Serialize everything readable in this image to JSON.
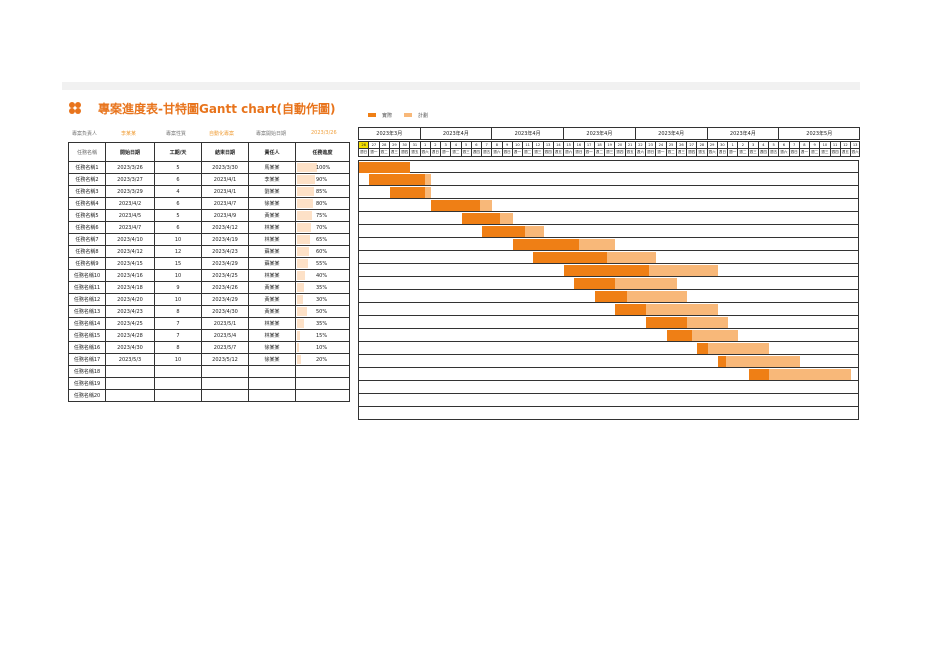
{
  "title": "專案進度表-甘特圖Gantt chart(自動作圖)",
  "info": {
    "owner_label": "專案負責人",
    "owner_value": "李某某",
    "category_label": "專案性質",
    "category_value": "自動化專案",
    "start_label": "專案開始日期",
    "start_value": "2023/3/26"
  },
  "legend": {
    "actual": "實際",
    "plan": "計劃"
  },
  "colors": {
    "actual": "#ef7f15",
    "plan": "#f8b879",
    "accent": "#e8741c",
    "today": "#f4de00",
    "progress": "#fde1c7"
  },
  "table": {
    "headers": [
      "任務名稱",
      "開始日期",
      "工期/天",
      "結束日期",
      "責任人",
      "任務進度"
    ],
    "rows": [
      [
        "任務名稱1",
        "2023/3/26",
        "5",
        "2023/3/30",
        "馬某某",
        "100%"
      ],
      [
        "任務名稱2",
        "2023/3/27",
        "6",
        "2023/4/1",
        "李某某",
        "90%"
      ],
      [
        "任務名稱3",
        "2023/3/29",
        "4",
        "2023/4/1",
        "劉某某",
        "85%"
      ],
      [
        "任務名稱4",
        "2023/4/2",
        "6",
        "2023/4/7",
        "徐某某",
        "80%"
      ],
      [
        "任務名稱5",
        "2023/4/5",
        "5",
        "2023/4/9",
        "黃某某",
        "75%"
      ],
      [
        "任務名稱6",
        "2023/4/7",
        "6",
        "2023/4/12",
        "林某某",
        "70%"
      ],
      [
        "任務名稱7",
        "2023/4/10",
        "10",
        "2023/4/19",
        "林某某",
        "65%"
      ],
      [
        "任務名稱8",
        "2023/4/12",
        "12",
        "2023/4/23",
        "蘇某某",
        "60%"
      ],
      [
        "任務名稱9",
        "2023/4/15",
        "15",
        "2023/4/29",
        "蘇某某",
        "55%"
      ],
      [
        "任務名稱10",
        "2023/4/16",
        "10",
        "2023/4/25",
        "林某某",
        "40%"
      ],
      [
        "任務名稱11",
        "2023/4/18",
        "9",
        "2023/4/26",
        "黃某某",
        "35%"
      ],
      [
        "任務名稱12",
        "2023/4/20",
        "10",
        "2023/4/29",
        "黃某某",
        "30%"
      ],
      [
        "任務名稱13",
        "2023/4/23",
        "8",
        "2023/4/30",
        "黃某某",
        "50%"
      ],
      [
        "任務名稱14",
        "2023/4/25",
        "7",
        "2023/5/1",
        "林某某",
        "35%"
      ],
      [
        "任務名稱15",
        "2023/4/28",
        "7",
        "2023/5/4",
        "林某某",
        "15%"
      ],
      [
        "任務名稱16",
        "2023/4/30",
        "8",
        "2023/5/7",
        "徐某某",
        "10%"
      ],
      [
        "任務名稱17",
        "2023/5/3",
        "10",
        "2023/5/12",
        "徐某某",
        "20%"
      ],
      [
        "任務名稱18",
        "",
        "",
        "",
        "",
        ""
      ],
      [
        "任務名稱19",
        "",
        "",
        "",
        "",
        ""
      ],
      [
        "任務名稱20",
        "",
        "",
        "",
        "",
        ""
      ]
    ]
  },
  "gantt": {
    "months": [
      "2023年3月",
      "2023年4月",
      "2023年4月",
      "2023年4月",
      "2023年4月",
      "2023年4月",
      "2023年5月"
    ],
    "days": [
      "26",
      "27",
      "28",
      "29",
      "30",
      "31",
      "1",
      "2",
      "3",
      "4",
      "5",
      "6",
      "7",
      "8",
      "9",
      "10",
      "11",
      "12",
      "13",
      "14",
      "15",
      "16",
      "17",
      "18",
      "19",
      "20",
      "21",
      "22",
      "23",
      "24",
      "25",
      "26",
      "27",
      "28",
      "29",
      "30",
      "1",
      "2",
      "3",
      "4",
      "5",
      "6",
      "7",
      "8",
      "9",
      "10",
      "11",
      "12",
      "13"
    ],
    "weekdays": [
      "週日",
      "週一",
      "週二",
      "週三",
      "週四",
      "週五",
      "週六",
      "週日",
      "週一",
      "週二",
      "週三",
      "週四",
      "週五",
      "週六",
      "週日",
      "週一",
      "週二",
      "週三",
      "週四",
      "週五",
      "週六",
      "週日",
      "週一",
      "週二",
      "週三",
      "週四",
      "週五",
      "週六",
      "週日",
      "週一",
      "週二",
      "週三",
      "週四",
      "週五",
      "週六",
      "週日",
      "週一",
      "週二",
      "週三",
      "週四",
      "週五",
      "週六",
      "週日",
      "週一",
      "週二",
      "週三",
      "週四",
      "週五",
      "週六"
    ],
    "today_index": 0
  }
}
